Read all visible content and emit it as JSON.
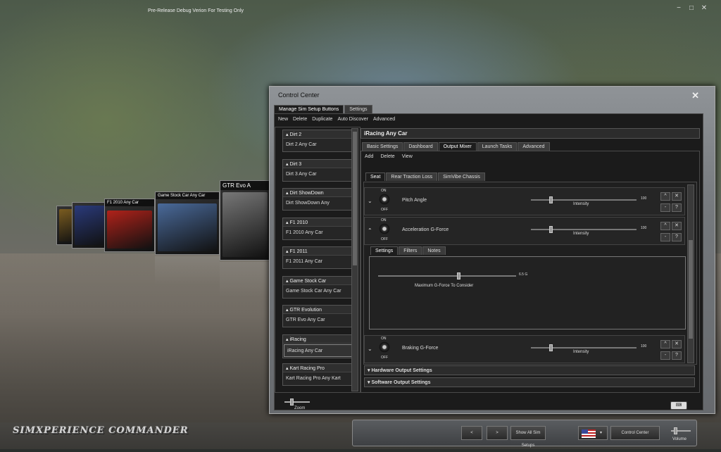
{
  "app": {
    "debug_text": "Pre-Release Debug Verion For Testing Only",
    "logo": "SIMXPERIENCE COMMANDER",
    "window_controls": [
      "−",
      "□",
      "✕"
    ]
  },
  "carousel": [
    {
      "title": "",
      "art": "#7a5c20"
    },
    {
      "title": "",
      "art": "#2a3a7a"
    },
    {
      "title": "F1 2010 Any Car",
      "art": "#b0221a"
    },
    {
      "title": "Game Stock Car Any Car",
      "art": "#4a6a9a"
    },
    {
      "title": "GTR Evo A",
      "art": "#777777"
    }
  ],
  "cc": {
    "title": "Control Center",
    "tabs": [
      "Manage Sim Setup Buttons",
      "Settings"
    ],
    "toolbar": [
      "New",
      "Delete",
      "Duplicate",
      "Auto Discover",
      "Advanced"
    ],
    "groups": [
      {
        "header": "Dirt 2",
        "item": "Dirt 2 Any Car"
      },
      {
        "header": "Dirt 3",
        "item": "Dirt 3 Any Car"
      },
      {
        "header": "Dirt ShowDown",
        "item": "Dirt ShowDown Any"
      },
      {
        "header": "F1 2010",
        "item": "F1 2010 Any Car"
      },
      {
        "header": "F1 2011",
        "item": "F1 2011 Any Car"
      },
      {
        "header": "Game Stock Car",
        "item": "Game Stock Car Any Car"
      },
      {
        "header": "GTR Evolution",
        "item": "GTR Evo Any Car"
      },
      {
        "header": "iRacing",
        "item": "iRacing Any Car"
      },
      {
        "header": "Kart Racing Pro",
        "item": "Kart Racing Pro Any Kart"
      }
    ],
    "selected_title": "iRacing Any Car",
    "detail_tabs": [
      "Basic Settings",
      "Dashboard",
      "Output Mixer",
      "Launch Tasks",
      "Advanced"
    ],
    "mixer_toolbar": [
      "Add",
      "Delete",
      "View"
    ],
    "mixer_tabs": [
      "Seat",
      "Rear Traction Loss",
      "SimVibe Chassis"
    ],
    "effects": [
      {
        "chev": "⌄",
        "name": "Pitch Angle",
        "value": "100",
        "label": "Intensity"
      },
      {
        "chev": "⌃",
        "name": "Acceleration G-Force",
        "value": "100",
        "label": "Intensity"
      },
      {
        "chev": "⌄",
        "name": "Braking G-Force",
        "value": "100",
        "label": "Intensity"
      }
    ],
    "on": "ON",
    "off": "OFF",
    "sub_tabs": [
      "Settings",
      "Filters",
      "Notes"
    ],
    "gforce": {
      "value": "6.5 G",
      "label": "Maximum G-Force To Consider"
    },
    "sections": [
      "Hardware Output Settings",
      "Software Output Settings"
    ],
    "zoom": "Zoom"
  },
  "bottom": {
    "prev": "<",
    "next": ">",
    "show_all": "Show All Sim Setups",
    "control_center": "Control Center",
    "volume": "Volume"
  }
}
